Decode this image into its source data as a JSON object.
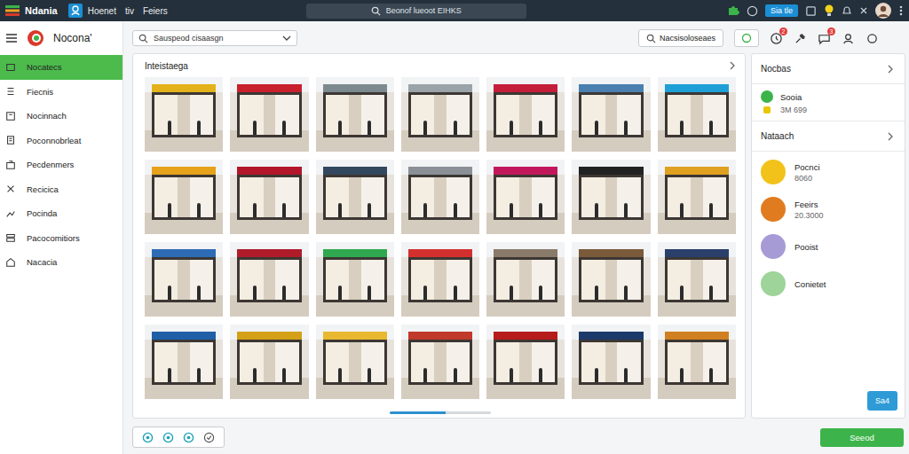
{
  "app": {
    "name": "Ndania"
  },
  "topnav": [
    "Hoenet",
    "tiv",
    "Feiers"
  ],
  "search": {
    "placeholder": "Beonof lueoot EIHKS"
  },
  "top_actions": {
    "pill": "Sia tle"
  },
  "sidebar": {
    "brand": "Nocona'",
    "items": [
      {
        "label": "Nocatecs",
        "selected": true
      },
      {
        "label": "Fiecnis",
        "selected": false
      },
      {
        "label": "Nocinnach",
        "selected": false
      },
      {
        "label": "Poconnobrleat",
        "selected": false
      },
      {
        "label": "Pecdenmers",
        "selected": false
      },
      {
        "label": "Recicica",
        "selected": false
      },
      {
        "label": "Pocinda",
        "selected": false
      },
      {
        "label": "Pacocomitiors",
        "selected": false
      },
      {
        "label": "Nacacia",
        "selected": false
      }
    ]
  },
  "toolbar": {
    "dropdown": "Sauspeod cisaasgn",
    "button": "Nacsisoloseaes",
    "badges": [
      "2",
      "3"
    ]
  },
  "gallery": {
    "title": "Inteistaega",
    "photos": [
      {
        "color": "#e3b21a"
      },
      {
        "color": "#c8202c"
      },
      {
        "color": "#7c8a8f"
      },
      {
        "color": "#9aa3a8"
      },
      {
        "color": "#c41e3a"
      },
      {
        "color": "#4a7fb0"
      },
      {
        "color": "#1ea0d6"
      },
      {
        "color": "#e6a21b"
      },
      {
        "color": "#b3162a"
      },
      {
        "color": "#33475e"
      },
      {
        "color": "#8a9096"
      },
      {
        "color": "#c2185b"
      },
      {
        "color": "#222222"
      },
      {
        "color": "#e0a020"
      },
      {
        "color": "#2d6bb5"
      },
      {
        "color": "#b01c2a"
      },
      {
        "color": "#2fa84f"
      },
      {
        "color": "#d32f2f"
      },
      {
        "color": "#8a7a6a"
      },
      {
        "color": "#7a5a3a"
      },
      {
        "color": "#2a3f6a"
      },
      {
        "color": "#1f5fa8"
      },
      {
        "color": "#d4a017"
      },
      {
        "color": "#e8b830"
      },
      {
        "color": "#c0392b"
      },
      {
        "color": "#b71c1c"
      },
      {
        "color": "#1b3a6a"
      },
      {
        "color": "#d08020"
      }
    ],
    "scroll": {
      "level": 0.55
    }
  },
  "right_panel": {
    "top": {
      "title": "Nocbas",
      "name": "Sooia",
      "sub": "3M 699",
      "color": "#3cb44b",
      "sub_color": "#e9c600"
    },
    "list": {
      "title": "Nataach",
      "items": [
        {
          "name": "Pocnci",
          "sub": "8060",
          "color": "#f2c21b"
        },
        {
          "name": "Feeirs",
          "sub": "20.3000",
          "color": "#e07b1f"
        },
        {
          "name": "Pooist",
          "sub": "",
          "color": "#a79bd6"
        },
        {
          "name": "Conietet",
          "sub": "",
          "color": "#9ed39a"
        }
      ]
    },
    "button": "Sa4"
  },
  "footer": {
    "button": "Seeod"
  }
}
